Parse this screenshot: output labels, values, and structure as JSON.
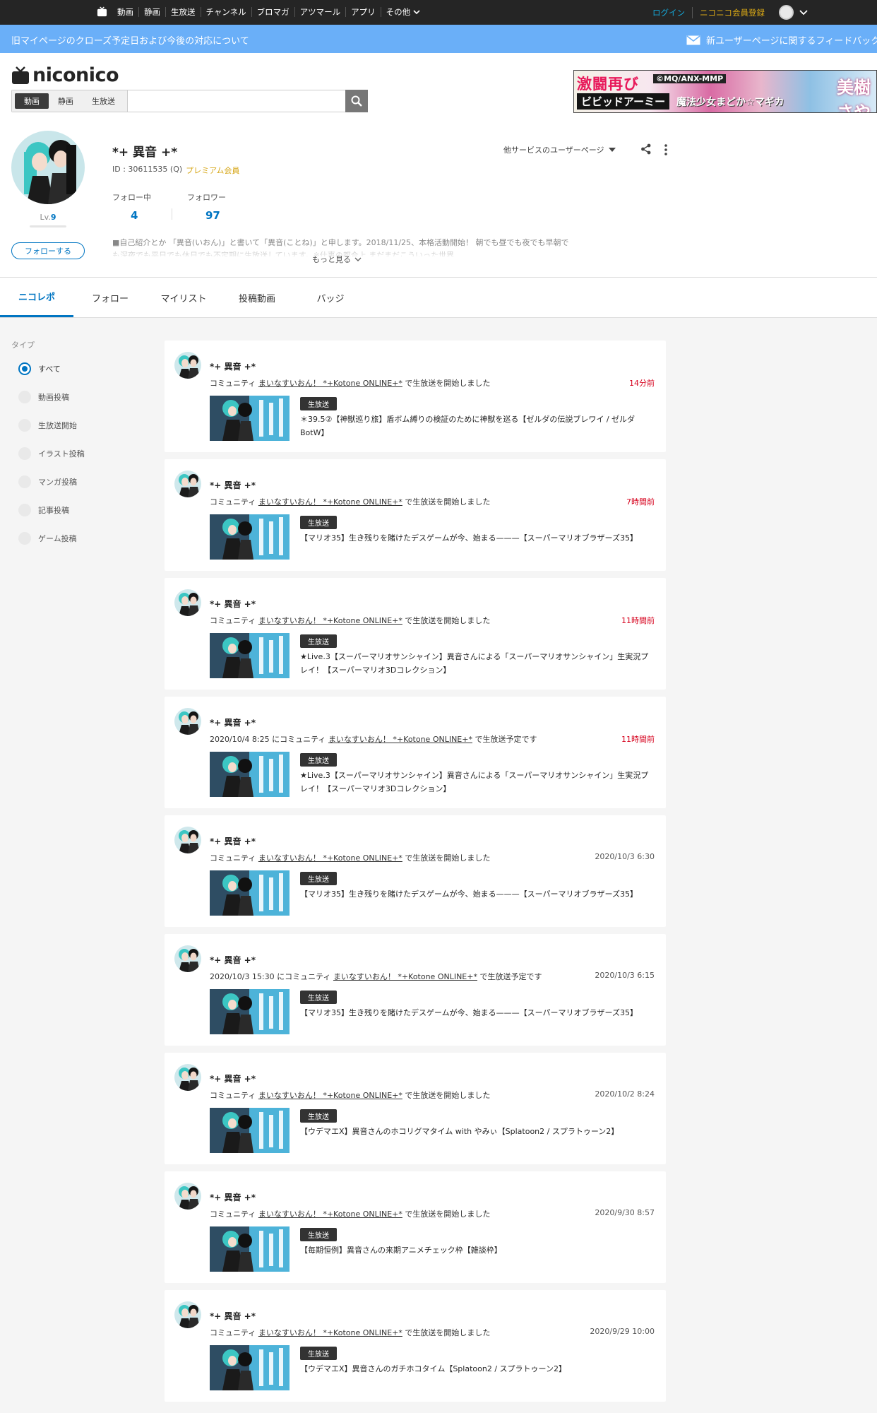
{
  "gnav": {
    "links": [
      "動画",
      "静画",
      "生放送",
      "チャンネル",
      "ブロマガ",
      "アツマール",
      "アプリ"
    ],
    "more": "その他",
    "login": "ログイン",
    "register": "ニコニコ会員登録"
  },
  "notice": {
    "left": "旧マイページのクローズ予定日および今後の対応について",
    "right": "新ユーザーページに関するフィードバック"
  },
  "header": {
    "logo": "niconico",
    "search_types": [
      "動画",
      "静画",
      "生放送"
    ],
    "search_placeholder": "",
    "banner": {
      "t1": "激闘再び",
      "t2": "©MQ/ANX-MMP",
      "t3": "ビビッドアーミー",
      "t4": "魔法少女まどか☆マギカ",
      "t5": "美樹さや"
    }
  },
  "profile": {
    "name": "*+ 異音 +*",
    "id_label": "ID : 30611535 (Q)",
    "premium": "プレミアム会員",
    "level_prefix": "Lv.",
    "level": "9",
    "follow_button": "フォローする",
    "following_label": "フォロー中",
    "following": "4",
    "followers_label": "フォロワー",
    "followers": "97",
    "description": "■自己紹介とか 「異音(いおん)」と書いて「異音(ことね)」と申します。2018/11/25、本格活動開始！ 朝でも昼でも夜でも早朝でも深夜でも平日でも休日でも不定期に生放送しています。※仕事の都合上 まだまだこういった世界",
    "more": "もっと見る",
    "other_services": "他サービスのユーザーページ"
  },
  "tabs": [
    "ニコレポ",
    "フォロー",
    "マイリスト",
    "投稿動画",
    "バッジ"
  ],
  "filter": {
    "title": "タイプ",
    "options": [
      "すべて",
      "動画投稿",
      "生放送開始",
      "イラスト投稿",
      "マンガ投稿",
      "記事投稿",
      "ゲーム投稿"
    ]
  },
  "feed": [
    {
      "name": "*+ 異音 +*",
      "pre": "コミュニティ ",
      "community": "まいなすいおん！ *+Kotone ONLINE+*",
      "post": " で生放送を開始しました",
      "time": "14分前",
      "badge": "生放送",
      "title": "＊39.5②【神獣巡り旅】盾ボム縛りの検証のために神獣を巡る【ゼルダの伝説ブレワイ / ゼルダBotW】"
    },
    {
      "name": "*+ 異音 +*",
      "pre": "コミュニティ ",
      "community": "まいなすいおん！ *+Kotone ONLINE+*",
      "post": " で生放送を開始しました",
      "time": "7時間前",
      "badge": "生放送",
      "title": "【マリオ35】生き残りを賭けたデスゲームが今、始まる———【スーパーマリオブラザーズ35】"
    },
    {
      "name": "*+ 異音 +*",
      "pre": "コミュニティ ",
      "community": "まいなすいおん！ *+Kotone ONLINE+*",
      "post": " で生放送を開始しました",
      "time": "11時間前",
      "badge": "生放送",
      "title": "★Live.3【スーパーマリオサンシャイン】異音さんによる「スーパーマリオサンシャイン」生実況プレイ！【スーパーマリオ3Dコレクション】"
    },
    {
      "name": "*+ 異音 +*",
      "pre": "2020/10/4 8:25 にコミュニティ ",
      "community": "まいなすいおん！ *+Kotone ONLINE+*",
      "post": " で生放送予定です",
      "time": "11時間前",
      "badge": "生放送",
      "title": "★Live.3【スーパーマリオサンシャイン】異音さんによる「スーパーマリオサンシャイン」生実況プレイ！【スーパーマリオ3Dコレクション】"
    },
    {
      "name": "*+ 異音 +*",
      "pre": "コミュニティ ",
      "community": "まいなすいおん！ *+Kotone ONLINE+*",
      "post": " で生放送を開始しました",
      "time": "2020/10/3 6:30",
      "badge": "生放送",
      "title": "【マリオ35】生き残りを賭けたデスゲームが今、始まる———【スーパーマリオブラザーズ35】"
    },
    {
      "name": "*+ 異音 +*",
      "pre": "2020/10/3 15:30 にコミュニティ ",
      "community": "まいなすいおん！ *+Kotone ONLINE+*",
      "post": " で生放送予定です",
      "time": "2020/10/3 6:15",
      "badge": "生放送",
      "title": "【マリオ35】生き残りを賭けたデスゲームが今、始まる———【スーパーマリオブラザーズ35】"
    },
    {
      "name": "*+ 異音 +*",
      "pre": "コミュニティ ",
      "community": "まいなすいおん！ *+Kotone ONLINE+*",
      "post": " で生放送を開始しました",
      "time": "2020/10/2 8:24",
      "badge": "生放送",
      "title": "【ウデマエX】異音さんのホコリグマタイム with やみぃ【Splatoon2 / スプラトゥーン2】"
    },
    {
      "name": "*+ 異音 +*",
      "pre": "コミュニティ ",
      "community": "まいなすいおん！ *+Kotone ONLINE+*",
      "post": " で生放送を開始しました",
      "time": "2020/9/30 8:57",
      "badge": "生放送",
      "title": "【毎期恒例】異音さんの来期アニメチェック枠【雑談枠】"
    },
    {
      "name": "*+ 異音 +*",
      "pre": "コミュニティ ",
      "community": "まいなすいおん！ *+Kotone ONLINE+*",
      "post": " で生放送を開始しました",
      "time": "2020/9/29 10:00",
      "badge": "生放送",
      "title": "【ウデマエX】異音さんのガチホコタイム【Splatoon2 / スプラトゥーン2】"
    }
  ],
  "colors": {
    "accent": "#0075c2",
    "notice": "#6aaff8",
    "premium": "#d6a616",
    "recent": "#d6001c"
  }
}
